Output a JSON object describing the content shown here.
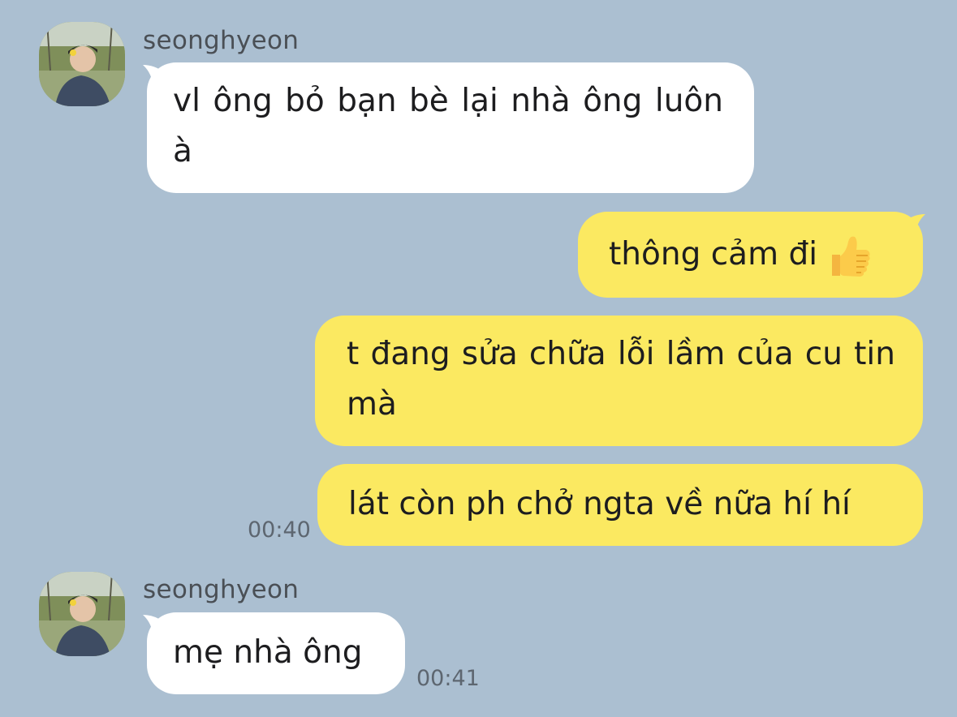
{
  "messages": [
    {
      "sender": "seonghyeon",
      "text": "vl ông bỏ bạn bè lại nhà ông luôn à"
    },
    {
      "text": "thông cảm đi"
    },
    {
      "text": "t đang sửa chữa lỗi lầm của cu tin mà"
    },
    {
      "text": "lát còn ph chở ngta về nữa hí hí",
      "time": "00:40"
    },
    {
      "sender": "seonghyeon",
      "text": "mẹ nhà ông",
      "time": "00:41"
    }
  ],
  "icons": {
    "thumbs_up": "thumbs-up-emoji",
    "avatar": "profile-photo"
  },
  "colors": {
    "background": "#abbfd1",
    "incoming_bubble": "#ffffff",
    "outgoing_bubble": "#fbe961"
  }
}
